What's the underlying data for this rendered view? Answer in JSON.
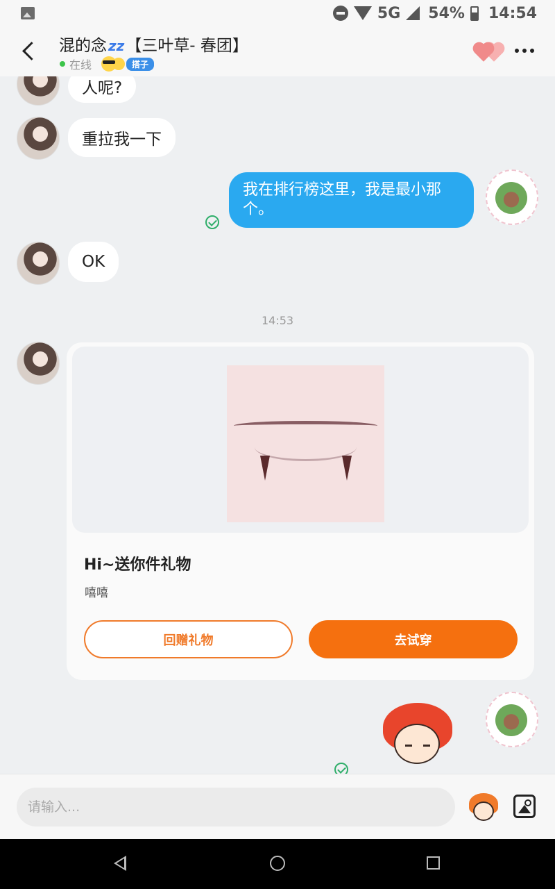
{
  "status_bar": {
    "network": "5G",
    "battery": "54%",
    "time": "14:54"
  },
  "header": {
    "contact_name": "混的念",
    "name_emoji": "zz",
    "group_tag": "【三叶草- 春团】",
    "status": "在线",
    "badge": "搭子"
  },
  "messages": [
    {
      "from": "them",
      "text": "人呢?"
    },
    {
      "from": "them",
      "text": "重拉我一下"
    },
    {
      "from": "me",
      "text_line1": "我在排行榜这里，我是最小那",
      "text_line2": "个。"
    },
    {
      "from": "them",
      "text": "OK"
    }
  ],
  "timestamp": "14:53",
  "gift_card": {
    "title": "Hi~送你件礼物",
    "subtitle": "嘻嘻",
    "return_gift_label": "回赠礼物",
    "try_on_label": "去试穿"
  },
  "input": {
    "placeholder": "请输入..."
  },
  "colors": {
    "my_bubble": "#2aa9f0",
    "accent_orange": "#f5700f",
    "online_green": "#3cc44a"
  }
}
